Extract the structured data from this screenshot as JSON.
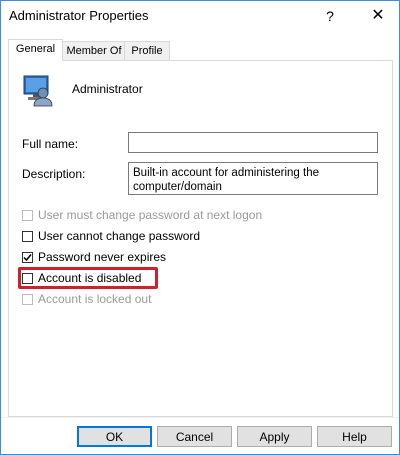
{
  "window": {
    "title": "Administrator Properties",
    "help_glyph": "?",
    "close_glyph": "✕"
  },
  "tabs": [
    {
      "label": "General",
      "active": true
    },
    {
      "label": "Member Of",
      "active": false
    },
    {
      "label": "Profile",
      "active": false
    }
  ],
  "user": {
    "name": "Administrator",
    "icon": "user-account-icon"
  },
  "fields": {
    "full_name_label": "Full name:",
    "full_name_value": "",
    "description_label": "Description:",
    "description_line1": "Built-in account for administering the",
    "description_line2": "computer/domain"
  },
  "checkboxes": [
    {
      "label": "User must change password at next logon",
      "checked": false,
      "disabled": true
    },
    {
      "label": "User cannot change password",
      "checked": false,
      "disabled": false
    },
    {
      "label": "Password never expires",
      "checked": true,
      "disabled": false
    },
    {
      "label": "Account is disabled",
      "checked": false,
      "disabled": false,
      "highlighted": true
    },
    {
      "label": "Account is locked out",
      "checked": false,
      "disabled": true
    }
  ],
  "buttons": {
    "ok": "OK",
    "cancel": "Cancel",
    "apply": "Apply",
    "help": "Help"
  },
  "colors": {
    "highlight": "#d0202c",
    "window_border": "#3c8fd6",
    "default_button": "#0078d7"
  }
}
